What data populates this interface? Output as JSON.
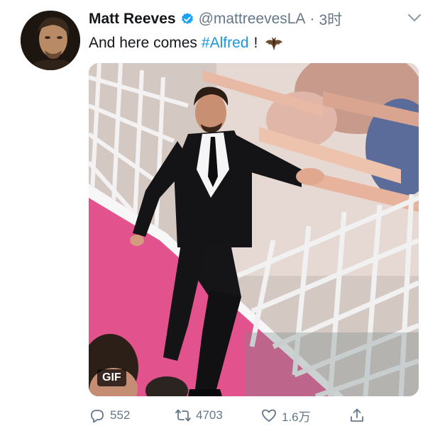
{
  "tweet": {
    "author_name": "Matt Reeves",
    "author_handle": "@mattreevesLA",
    "separator": "·",
    "time": "3时",
    "text_before": "And here comes",
    "hashtag": "#Alfred",
    "text_after": "!",
    "emoji": "bat-emoji",
    "media": {
      "badge": "GIF",
      "description_icon": "red-carpet-gif"
    },
    "actions": {
      "reply_count": "552",
      "retweet_count": "4703",
      "like_count": "1.6万"
    }
  },
  "colors": {
    "link": "#1b95e0",
    "muted": "#657786",
    "verified": "#1da1f2",
    "carpet": "#e0508a"
  },
  "icons": [
    "verified-badge-icon",
    "chevron-down-icon",
    "reply-icon",
    "retweet-icon",
    "like-icon",
    "share-icon"
  ]
}
